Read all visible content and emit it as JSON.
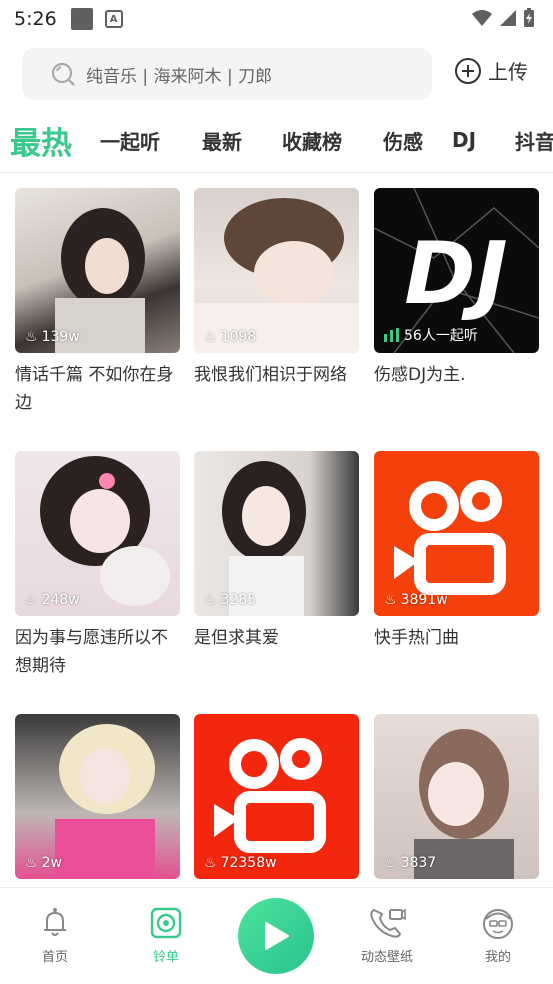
{
  "status_bar": {
    "time": "5:26"
  },
  "search": {
    "placeholder": "纯音乐 | 海来阿木 | 刀郎",
    "upload_label": "上传"
  },
  "tabs": [
    "最热",
    "一起听",
    "最新",
    "收藏榜",
    "伤感",
    "DJ",
    "抖音"
  ],
  "playlists": [
    {
      "count": "139w",
      "title": "情话千篇 不如你在身边",
      "count_type": "hot"
    },
    {
      "count": "1098",
      "title": "我恨我们相识于网络",
      "count_type": "hot"
    },
    {
      "count": "56人一起听",
      "title": "伤感DJ为主.",
      "count_type": "listening"
    },
    {
      "count": "248w",
      "title": "因为事与愿违所以不想期待",
      "count_type": "hot"
    },
    {
      "count": "3285",
      "title": "是但求其爱",
      "count_type": "hot"
    },
    {
      "count": "3891w",
      "title": "快手热门曲",
      "count_type": "hot"
    },
    {
      "count": "2w",
      "title": "",
      "count_type": "hot"
    },
    {
      "count": "72358w",
      "title": "",
      "count_type": "hot"
    },
    {
      "count": "3837",
      "title": "",
      "count_type": "hot"
    }
  ],
  "dj_cover_text": "DJ",
  "nav": [
    {
      "label": "首页",
      "icon": "bell-icon"
    },
    {
      "label": "铃单",
      "icon": "playlist-icon"
    },
    {
      "label": "",
      "icon": "play-icon"
    },
    {
      "label": "动态壁纸",
      "icon": "phone-icon"
    },
    {
      "label": "我的",
      "icon": "profile-icon"
    }
  ],
  "colors": {
    "accent": "#3ac98a",
    "kuaishou": "#f4400a"
  }
}
